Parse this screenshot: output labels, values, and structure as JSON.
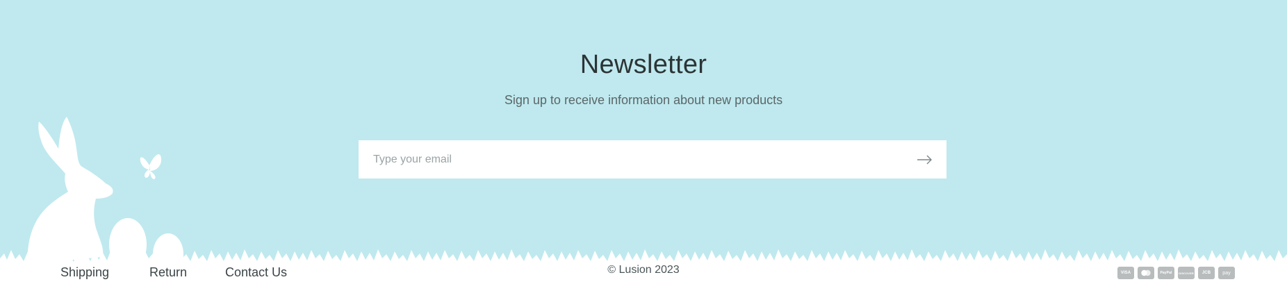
{
  "newsletter": {
    "title": "Newsletter",
    "subtitle": "Sign up to receive information about new products",
    "email_placeholder": "Type your email",
    "submit_icon": "arrow-right-icon"
  },
  "footer": {
    "links": [
      "Shipping",
      "Return",
      "Contact Us"
    ],
    "copyright": "© Lusion 2023",
    "payment_icons": [
      {
        "name": "visa-icon",
        "label": "VISA"
      },
      {
        "name": "mastercard-icon",
        "label": ""
      },
      {
        "name": "paypal-icon",
        "label": "PayPal"
      },
      {
        "name": "discover-icon",
        "label": "DISCOVER"
      },
      {
        "name": "jcb-icon",
        "label": "JCB"
      },
      {
        "name": "amazon-pay-icon",
        "label": "pay"
      }
    ]
  },
  "colors": {
    "background": "#bfe9ee",
    "text": "#2f3b3d",
    "decoration": "#ffffff"
  }
}
